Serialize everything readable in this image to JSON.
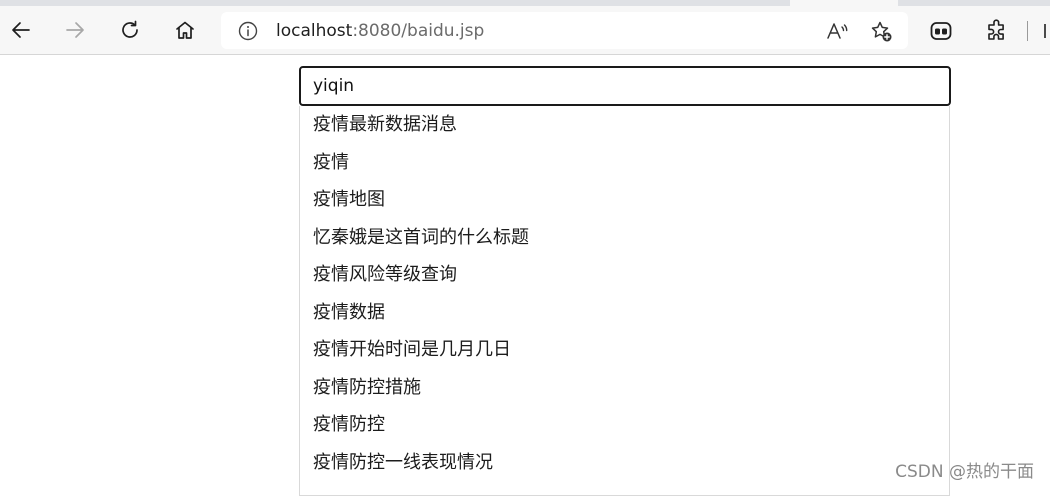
{
  "browser": {
    "url_host": "localhost",
    "url_rest": ":8080/baidu.jsp"
  },
  "search": {
    "value": "yiqin"
  },
  "suggestions": [
    "疫情最新数据消息",
    "疫情",
    "疫情地图",
    "忆秦娥是这首词的什么标题",
    "疫情风险等级查询",
    "疫情数据",
    "疫情开始时间是几月几日",
    "疫情防控措施",
    "疫情防控",
    "疫情防控一线表现情况"
  ],
  "watermark": "CSDN @热的干面",
  "icons": [
    "back-icon",
    "forward-icon",
    "refresh-icon",
    "home-icon",
    "info-icon",
    "read-aloud-icon",
    "add-favorite-icon",
    "collections-icon",
    "extensions-icon"
  ]
}
